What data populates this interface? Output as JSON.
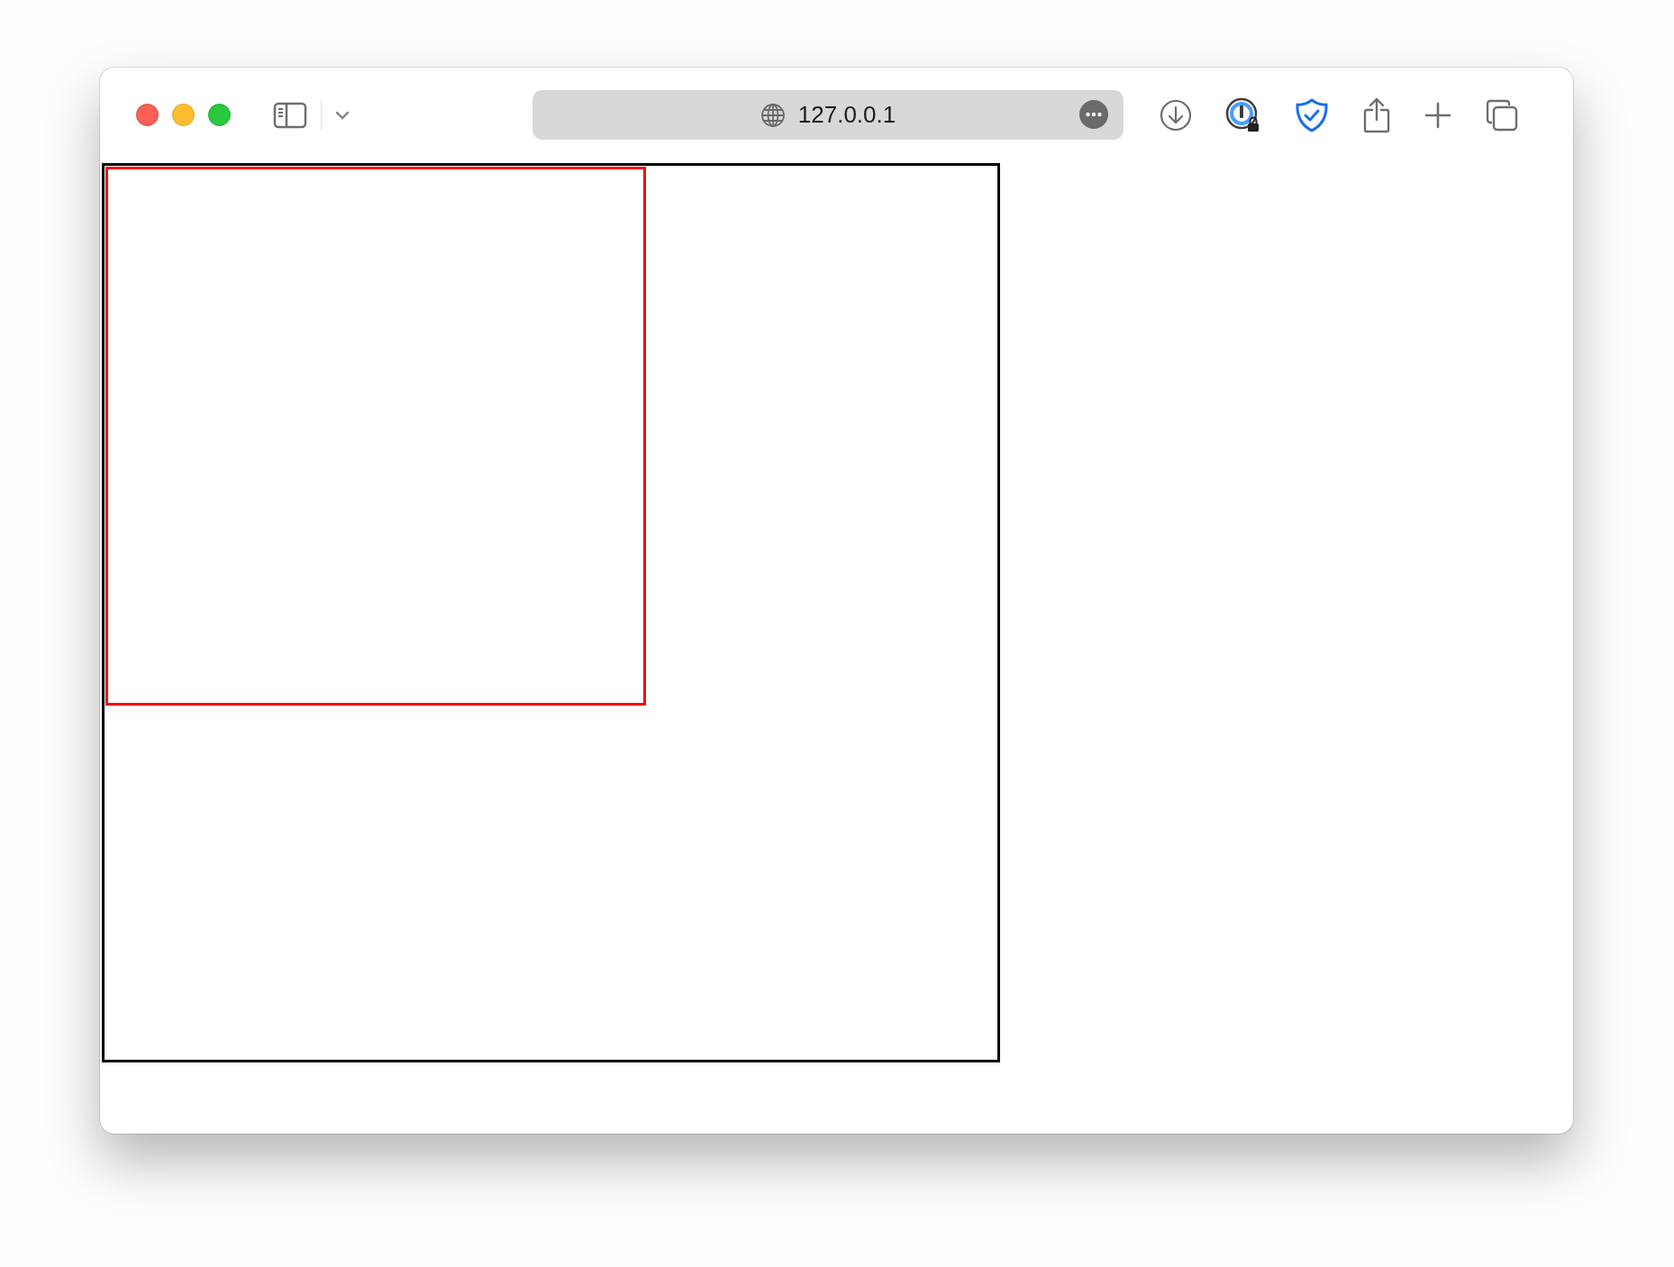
{
  "window": {
    "address": "127.0.0.1"
  }
}
